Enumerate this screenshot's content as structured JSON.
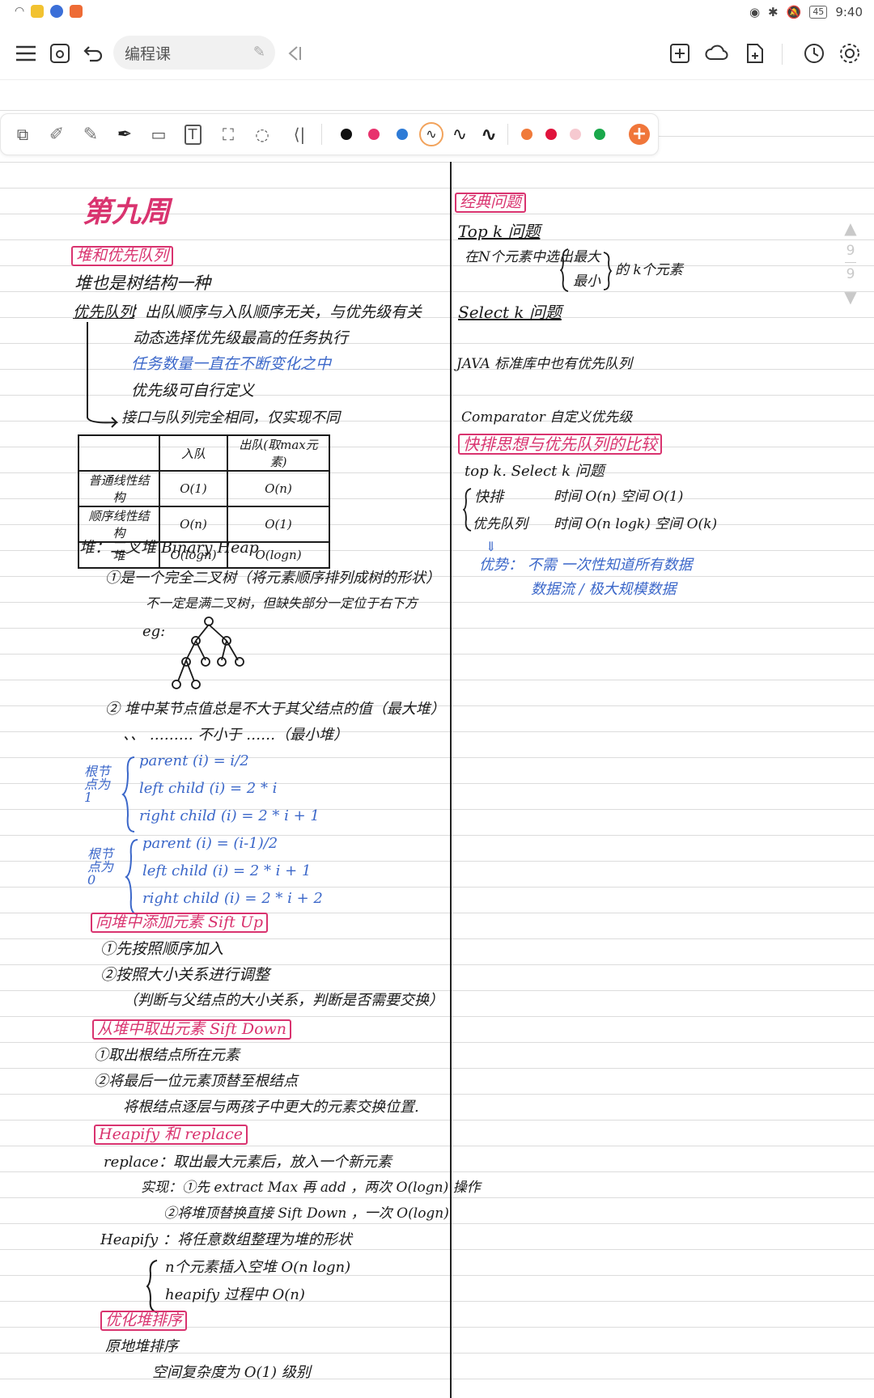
{
  "status": {
    "time": "9:40",
    "battery": "45"
  },
  "header": {
    "title": "编程课"
  },
  "toolbar": {
    "colors": [
      "#111111",
      "#e8336d",
      "#2e7bd6",
      "#ffa64d",
      "#111111",
      "#111111",
      "#f07a3a",
      "#e0143c",
      "#f6c9d0",
      "#1aa84b"
    ]
  },
  "scroll": {
    "page_current": "9",
    "page_total": "9"
  },
  "left": {
    "week_title": "第九周",
    "h_heap_pq": "堆和优先队列",
    "l1": "堆也是树结构一种",
    "pq_label": "优先队列",
    "pq_def": "：出队顺序与入队顺序无关，与优先级有关",
    "pq_2": "动态选择优先级最高的任务执行",
    "pq_3": "任务数量一直在不断变化之中",
    "pq_4": "优先级可自行定义",
    "pq_5": "接口与队列完全相同，仅实现不同",
    "table": {
      "header": [
        "",
        "入队",
        "出队(取max元素)"
      ],
      "rows": [
        [
          "普通线性结构",
          "O(1)",
          "O(n)"
        ],
        [
          "顺序线性结构",
          "O(n)",
          "O(1)"
        ],
        [
          "堆",
          "O(logn)",
          "O(logn)"
        ]
      ]
    },
    "heap_line": "堆：二叉堆  Binary  Heap",
    "h1": "①是一个完全二叉树（将元素顺序排列成树的形状）",
    "h1b": "不一定是满二叉树，但缺失部分一定位于右下方",
    "eg": "eg:",
    "h2": "② 堆中某节点值总是不大于其父结点的值（最大堆）",
    "h2b": "、、 ……… 不小于 ……（最小堆）",
    "root1_label": "根节点为 1",
    "idx1": [
      "parent (i) = i/2",
      "left  child (i) = 2 * i",
      "right  child (i) = 2 * i + 1"
    ],
    "root0_label": "根节点为 0",
    "idx0": [
      "parent (i) = (i-1)/2",
      "left  child (i) = 2 * i + 1",
      "right  child (i) = 2 * i + 2"
    ],
    "h_siftup": "向堆中添加元素    Sift  Up",
    "su1": "①先按照顺序加入",
    "su2": "②按照大小关系进行调整",
    "su3": "（判断与父结点的大小关系，判断是否需要交换）",
    "h_siftdown": "从堆中取出元素     Sift  Down",
    "sd1": "①取出根结点所在元素",
    "sd2": "②将最后一位元素顶替至根结点",
    "sd3": "将根结点逐层与两孩子中更大的元素交换位置.",
    "h_heapify": "Heapify  和  replace",
    "rp1": "replace：取出最大元素后，放入一个新元素",
    "rp2": "实现：①先 extract Max  再 add ，两次 O(logn) 操作",
    "rp3": "②将堆顶替换直接 Sift Down ，一次 O(logn)",
    "hp1": "Heapify ：将任意数组整理为堆的形状",
    "hp2": "n个元素插入空堆     O(n logn)",
    "hp3": "heapify 过程中       O(n)",
    "h_opt": "优化堆排序",
    "op1": "原地堆排序",
    "op2": "空间复杂度为  O(1)  级别"
  },
  "right": {
    "h_classic": "经典问题",
    "top_k": "Top   k  问题",
    "tk_desc": "在N个元素中选出",
    "tk_big": "最大",
    "tk_small": "最小",
    "tk_end": "的 k个元素",
    "select_k": "Select   k  问题",
    "java": "JAVA 标准库中也有优先队列",
    "comparator": "Comparator    自定义优先级",
    "h_compare": "快排思想与优先队列的比较",
    "cmp_head": "top  k.    Select   k  问题",
    "qs_label": "快排",
    "qs_vals": "时间    O(n)      空间   O(1)",
    "pq_label": "优先队列",
    "pq_vals": "时间   O(n logk)  空间 O(k)",
    "adv1": "优势：  不需  一次性知道所有数据",
    "adv2": "数据流 /     极大规模数据"
  }
}
